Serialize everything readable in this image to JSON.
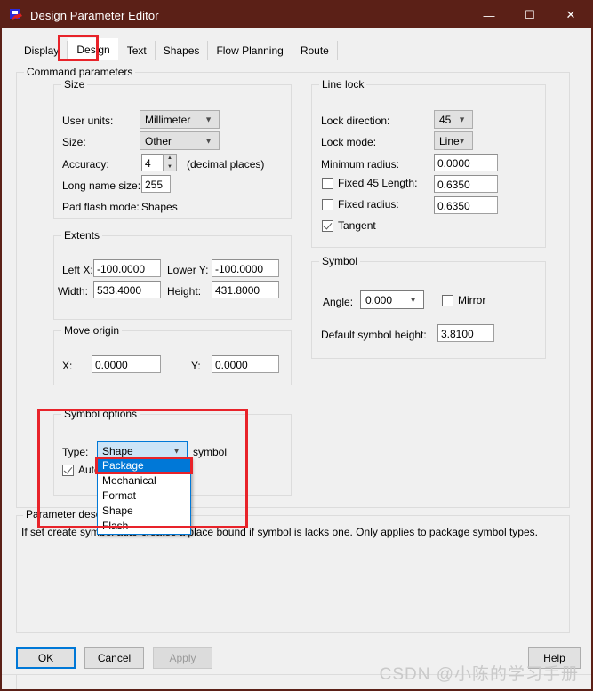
{
  "window": {
    "title": "Design Parameter Editor",
    "icon": "app-icon",
    "minimize": "—",
    "maximize": "☐",
    "close": "✕",
    "titlebar_color": "#5b2017",
    "border_color": "#5b2017"
  },
  "tabs": [
    {
      "label": "Display",
      "selected": false
    },
    {
      "label": "Design",
      "selected": true
    },
    {
      "label": "Text",
      "selected": false
    },
    {
      "label": "Shapes",
      "selected": false
    },
    {
      "label": "Flow Planning",
      "selected": false
    },
    {
      "label": "Route",
      "selected": false
    }
  ],
  "command_parameters": {
    "label": "Command parameters",
    "size": {
      "label": "Size",
      "user_units_label": "User units:",
      "user_units_value": "Millimeter",
      "size_label": "Size:",
      "size_value": "Other",
      "accuracy_label": "Accuracy:",
      "accuracy_value": "4",
      "accuracy_suffix": "(decimal places)",
      "long_name_size_label": "Long name size:",
      "long_name_size_value": "255",
      "pad_flash_mode_label": "Pad flash mode:",
      "pad_flash_mode_value": "Shapes"
    },
    "line_lock": {
      "label": "Line lock",
      "lock_direction_label": "Lock direction:",
      "lock_direction_value": "45",
      "lock_mode_label": "Lock mode:",
      "lock_mode_value": "Line",
      "minimum_radius_label": "Minimum radius:",
      "minimum_radius_value": "0.0000",
      "fixed_45_length_label": "Fixed 45 Length:",
      "fixed_45_length_value": "0.6350",
      "fixed_45_length_checked": false,
      "fixed_radius_label": "Fixed radius:",
      "fixed_radius_value": "0.6350",
      "fixed_radius_checked": false,
      "tangent_label": "Tangent",
      "tangent_checked": true
    },
    "extents": {
      "label": "Extents",
      "left_x_label": "Left X:",
      "left_x_value": "-100.0000",
      "lower_y_label": "Lower Y:",
      "lower_y_value": "-100.0000",
      "width_label": "Width:",
      "width_value": "533.4000",
      "height_label": "Height:",
      "height_value": "431.8000"
    },
    "move_origin": {
      "label": "Move origin",
      "x_label": "X:",
      "x_value": "0.0000",
      "y_label": "Y:",
      "y_value": "0.0000"
    },
    "symbol": {
      "label": "Symbol",
      "angle_label": "Angle:",
      "angle_value": "0.000",
      "mirror_label": "Mirror",
      "mirror_checked": false,
      "default_symbol_height_label": "Default symbol height:",
      "default_symbol_height_value": "3.8100"
    },
    "symbol_options": {
      "label": "Symbol options",
      "type_label": "Type:",
      "type_value": "Shape",
      "type_suffix": "symbol",
      "auto_label": "Auto",
      "auto_checked": true,
      "dropdown_open": true,
      "dropdown_options": [
        {
          "label": "Package",
          "selected": true
        },
        {
          "label": "Mechanical",
          "selected": false
        },
        {
          "label": "Format",
          "selected": false
        },
        {
          "label": "Shape",
          "selected": false
        },
        {
          "label": "Flash",
          "selected": false
        }
      ]
    }
  },
  "parameter_description": {
    "label": "Parameter description",
    "text": "If set create symbol auto-creates a place bound if symbol is lacks one. Only applies to package symbol types."
  },
  "buttons": {
    "ok": "OK",
    "cancel": "Cancel",
    "apply": "Apply",
    "apply_enabled": false,
    "help": "Help"
  },
  "watermark": "CSDN @小陈的学习手册",
  "annotation_color": "#e8232a"
}
